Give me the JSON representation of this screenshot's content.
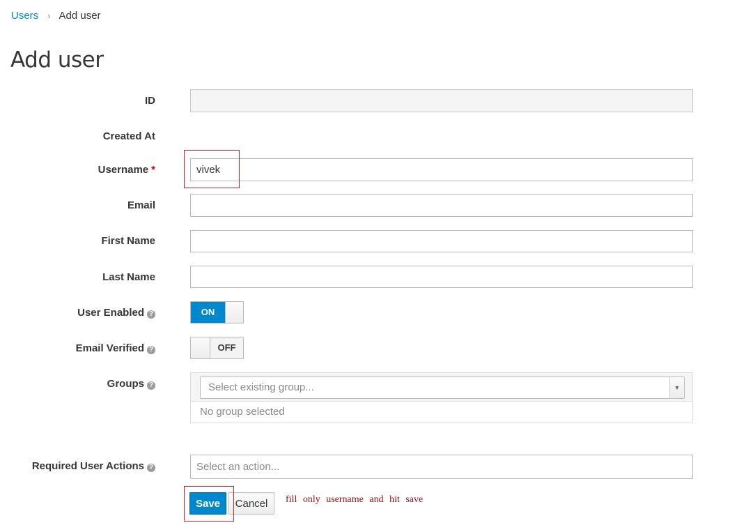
{
  "breadcrumb": {
    "parent": "Users",
    "separator": "›",
    "current": "Add user"
  },
  "page_title": "Add user",
  "form": {
    "id": {
      "label": "ID",
      "value": ""
    },
    "created_at": {
      "label": "Created At"
    },
    "username": {
      "label": "Username",
      "required_mark": "*",
      "value": "vivek"
    },
    "email": {
      "label": "Email",
      "value": ""
    },
    "first_name": {
      "label": "First Name",
      "value": ""
    },
    "last_name": {
      "label": "Last Name",
      "value": ""
    },
    "user_enabled": {
      "label": "User Enabled",
      "state": "ON",
      "on": true
    },
    "email_verified": {
      "label": "Email Verified",
      "state": "OFF",
      "on": false
    },
    "groups": {
      "label": "Groups",
      "placeholder": "Select existing group...",
      "empty_text": "No group selected"
    },
    "required_actions": {
      "label": "Required User Actions",
      "placeholder": "Select an action..."
    }
  },
  "buttons": {
    "save": "Save",
    "cancel": "Cancel"
  },
  "help_icon_glyph": "?",
  "annotation": {
    "note": "fill only username and hit save",
    "color": "#a01010",
    "highlight_color": "#d8202a"
  },
  "colors": {
    "accent": "#0088ce",
    "link": "#0088ce",
    "required": "#cc0000"
  }
}
